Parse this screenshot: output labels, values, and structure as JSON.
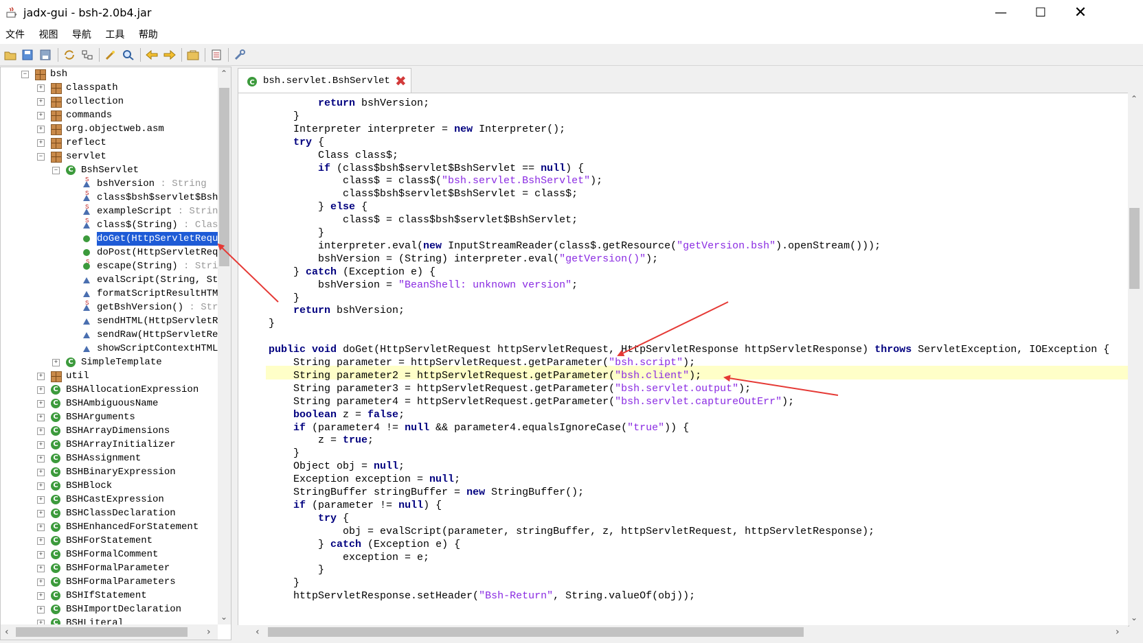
{
  "window": {
    "title": "jadx-gui - bsh-2.0b4.jar"
  },
  "menu": [
    "文件",
    "视图",
    "导航",
    "工具",
    "帮助"
  ],
  "tree": {
    "root": "bsh",
    "packages_top": [
      "classpath",
      "collection",
      "commands",
      "org.objectweb.asm",
      "reflect",
      "servlet"
    ],
    "servlet_class": "BshServlet",
    "members": [
      {
        "name": "bshVersion",
        "type": " : String"
      },
      {
        "name": "class$bsh$servlet$Bsh",
        "type": ""
      },
      {
        "name": "exampleScript",
        "type": " : Strin"
      },
      {
        "name": "class$(String)",
        "type": " : Clas"
      },
      {
        "name": "doGet(HttpServletRequ",
        "type": ""
      },
      {
        "name": "doPost(HttpServletReq",
        "type": ""
      },
      {
        "name": "escape(String)",
        "type": " : Stri"
      },
      {
        "name": "evalScript(String, St",
        "type": ""
      },
      {
        "name": "formatScriptResultHTM",
        "type": ""
      },
      {
        "name": "getBshVersion()",
        "type": " : Str"
      },
      {
        "name": "sendHTML(HttpServletR",
        "type": ""
      },
      {
        "name": "sendRaw(HttpServletRe",
        "type": ""
      },
      {
        "name": "showScriptContextHTML",
        "type": ""
      }
    ],
    "simple_template": "SimpleTemplate",
    "util": "util",
    "classes": [
      "BSHAllocationExpression",
      "BSHAmbiguousName",
      "BSHArguments",
      "BSHArrayDimensions",
      "BSHArrayInitializer",
      "BSHAssignment",
      "BSHBinaryExpression",
      "BSHBlock",
      "BSHCastExpression",
      "BSHClassDeclaration",
      "BSHEnhancedForStatement",
      "BSHForStatement",
      "BSHFormalComment",
      "BSHFormalParameter",
      "BSHFormalParameters",
      "BSHIfStatement",
      "BSHImportDeclaration",
      "BSHLiteral"
    ]
  },
  "tab": {
    "label": "bsh.servlet.BshServlet"
  },
  "code": [
    "            return bshVersion;",
    "        }",
    "        Interpreter interpreter = new Interpreter();",
    "        try {",
    "            Class class$;",
    "            if (class$bsh$servlet$BshServlet == null) {",
    "                class$ = class$(\"bsh.servlet.BshServlet\");",
    "                class$bsh$servlet$BshServlet = class$;",
    "            } else {",
    "                class$ = class$bsh$servlet$BshServlet;",
    "            }",
    "            interpreter.eval(new InputStreamReader(class$.getResource(\"getVersion.bsh\").openStream()));",
    "            bshVersion = (String) interpreter.eval(\"getVersion()\");",
    "        } catch (Exception e) {",
    "            bshVersion = \"BeanShell: unknown version\";",
    "        }",
    "        return bshVersion;",
    "    }",
    "",
    "    public void doGet(HttpServletRequest httpServletRequest, HttpServletResponse httpServletResponse) throws ServletException, IOException {",
    "        String parameter = httpServletRequest.getParameter(\"bsh.script\");",
    "        String parameter2 = httpServletRequest.getParameter(\"bsh.client\");",
    "        String parameter3 = httpServletRequest.getParameter(\"bsh.servlet.output\");",
    "        String parameter4 = httpServletRequest.getParameter(\"bsh.servlet.captureOutErr\");",
    "        boolean z = false;",
    "        if (parameter4 != null && parameter4.equalsIgnoreCase(\"true\")) {",
    "            z = true;",
    "        }",
    "        Object obj = null;",
    "        Exception exception = null;",
    "        StringBuffer stringBuffer = new StringBuffer();",
    "        if (parameter != null) {",
    "            try {",
    "                obj = evalScript(parameter, stringBuffer, z, httpServletRequest, httpServletResponse);",
    "            } catch (Exception e) {",
    "                exception = e;",
    "            }",
    "        }",
    "        httpServletResponse.setHeader(\"Bsh-Return\", String.valueOf(obj));"
  ],
  "colors": {
    "selection": "#1e5bd6",
    "keyword": "#00007f",
    "string": "#8a2be2",
    "highlight": "#ffffc8",
    "annotation": "#e53935"
  }
}
